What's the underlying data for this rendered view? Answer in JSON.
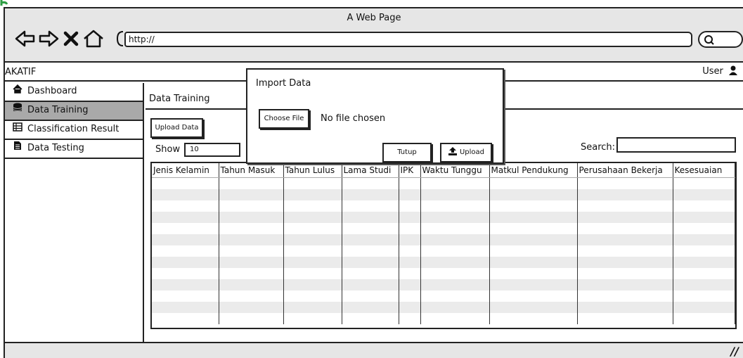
{
  "browser": {
    "window_title": "A Web Page",
    "url": "http://",
    "nav_icons": [
      "back-arrow-icon",
      "forward-arrow-icon",
      "close-x-icon",
      "home-icon"
    ]
  },
  "app": {
    "title": "AKATIF",
    "user_label": "User"
  },
  "sidebar": {
    "items": [
      {
        "label": "Dashboard",
        "icon": "home-icon"
      },
      {
        "label": "Data Training",
        "icon": "database-icon",
        "active": true
      },
      {
        "label": "Classification Result",
        "icon": "table-icon"
      },
      {
        "label": "Data Testing",
        "icon": "document-icon"
      }
    ]
  },
  "content": {
    "page_title": "Data Training",
    "upload_button": "Upload Data",
    "show_label": "Show",
    "show_value": "10",
    "search_label": "Search:"
  },
  "table": {
    "columns": [
      "Jenis Kelamin",
      "Tahun Masuk",
      "Tahun Lulus",
      "Lama Studi",
      "IPK",
      "Waktu Tunggu",
      "Matkul Pendukung",
      "Perusahaan Bekerja",
      "Kesesuaian"
    ],
    "row_count": 13
  },
  "modal": {
    "title": "Import Data",
    "choose_file_label": "Choose File",
    "file_status": "No file chosen",
    "close_label": "Tutup",
    "upload_label": "Upload"
  },
  "colors": {
    "chrome_gray": "#e6e6e6",
    "active_item": "#a9a9a9",
    "stripe": "#ebebeb",
    "logo_green": "#2f9e44"
  }
}
